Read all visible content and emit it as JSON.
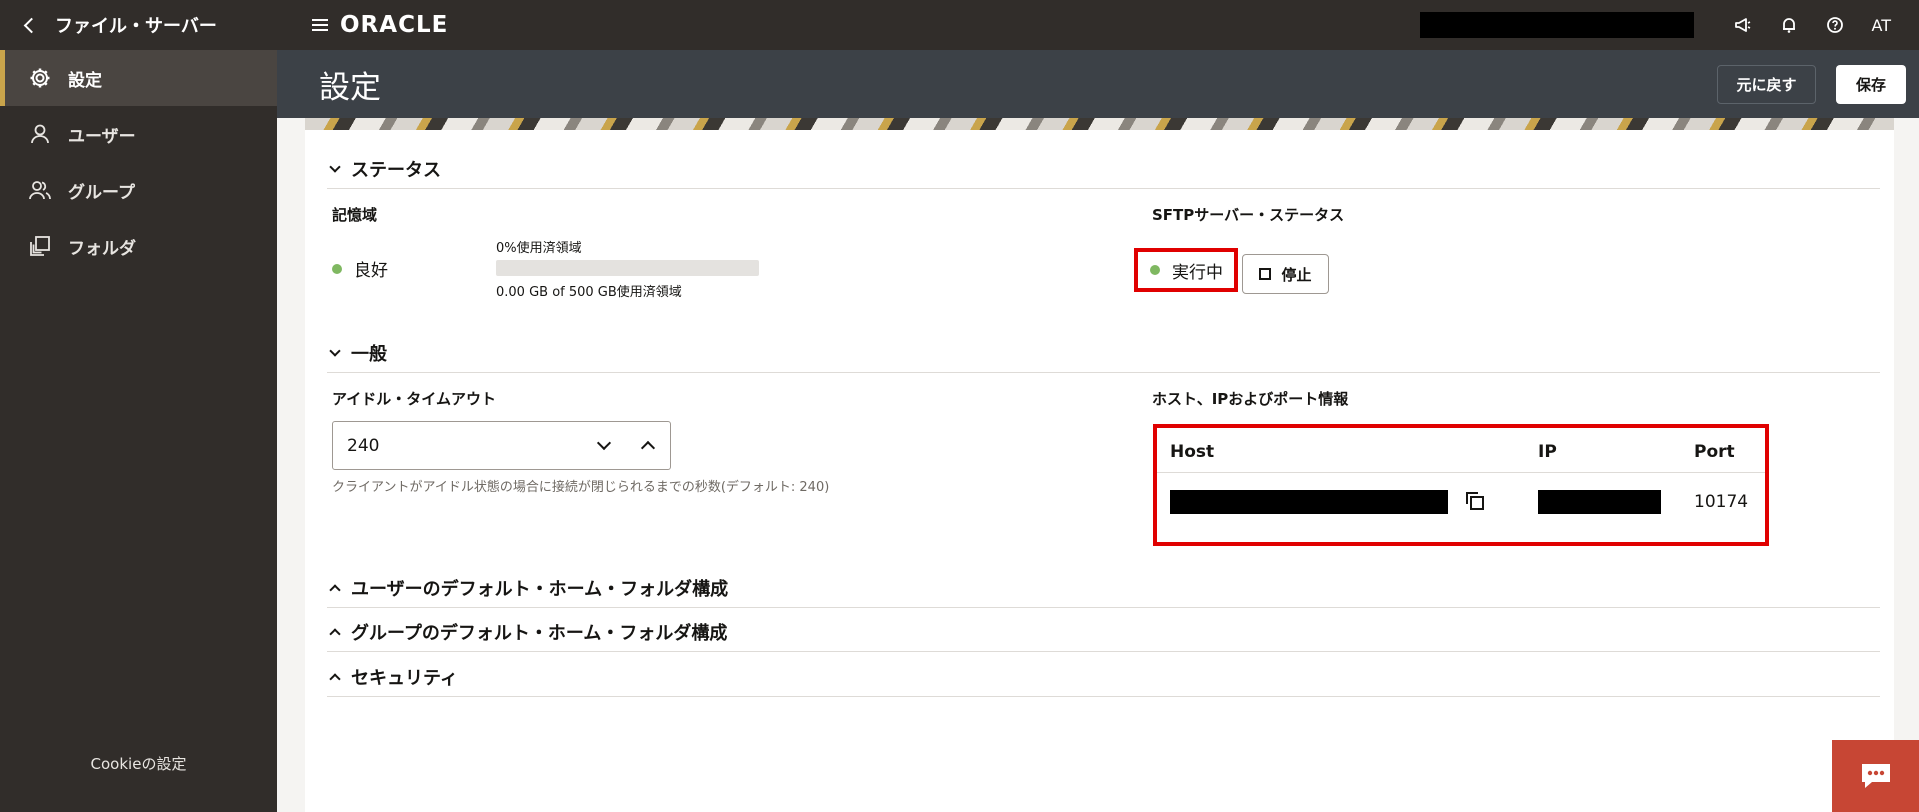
{
  "topbar": {
    "back_label": "ファイル・サーバー",
    "logo": "ORACLE",
    "user_initials": "AT",
    "icons": [
      "megaphone-icon",
      "bell-icon",
      "help-icon"
    ]
  },
  "sidebar": {
    "items": [
      {
        "label": "設定",
        "icon": "gear-icon",
        "active": true
      },
      {
        "label": "ユーザー",
        "icon": "user-icon",
        "active": false
      },
      {
        "label": "グループ",
        "icon": "group-icon",
        "active": false
      },
      {
        "label": "フォルダ",
        "icon": "folder-icon",
        "active": false
      }
    ],
    "cookie_label": "Cookieの設定"
  },
  "header": {
    "title": "設定",
    "revert_label": "元に戻す",
    "save_label": "保存"
  },
  "status": {
    "section_title": "ステータス",
    "storage_label": "記憶域",
    "storage_status": "良好",
    "usage_percent_label": "0%使用済領域",
    "usage_fraction": 0,
    "usage_detail": "0.00 GB of 500 GB使用済領域",
    "sftp_label": "SFTPサーバー・ステータス",
    "sftp_status": "実行中",
    "stop_label": "停止"
  },
  "general": {
    "section_title": "一般",
    "idle_label": "アイドル・タイムアウト",
    "idle_value": "240",
    "idle_help": "クライアントがアイドル状態の場合に接続が閉じられるまでの秒数(デフォルト: 240)",
    "host_info_label": "ホスト、IPおよびポート情報",
    "table": {
      "headers": [
        "Host",
        "IP",
        "Port"
      ],
      "port": "10174"
    }
  },
  "collapsed_sections": [
    "ユーザーのデフォルト・ホーム・フォルダ構成",
    "グループのデフォルト・ホーム・フォルダ構成",
    "セキュリティ"
  ],
  "colors": {
    "topbar": "#312d2a",
    "header": "#3c4147",
    "status_green": "#7fb861",
    "highlight_red": "#e00000",
    "chat_button": "#c74634"
  }
}
